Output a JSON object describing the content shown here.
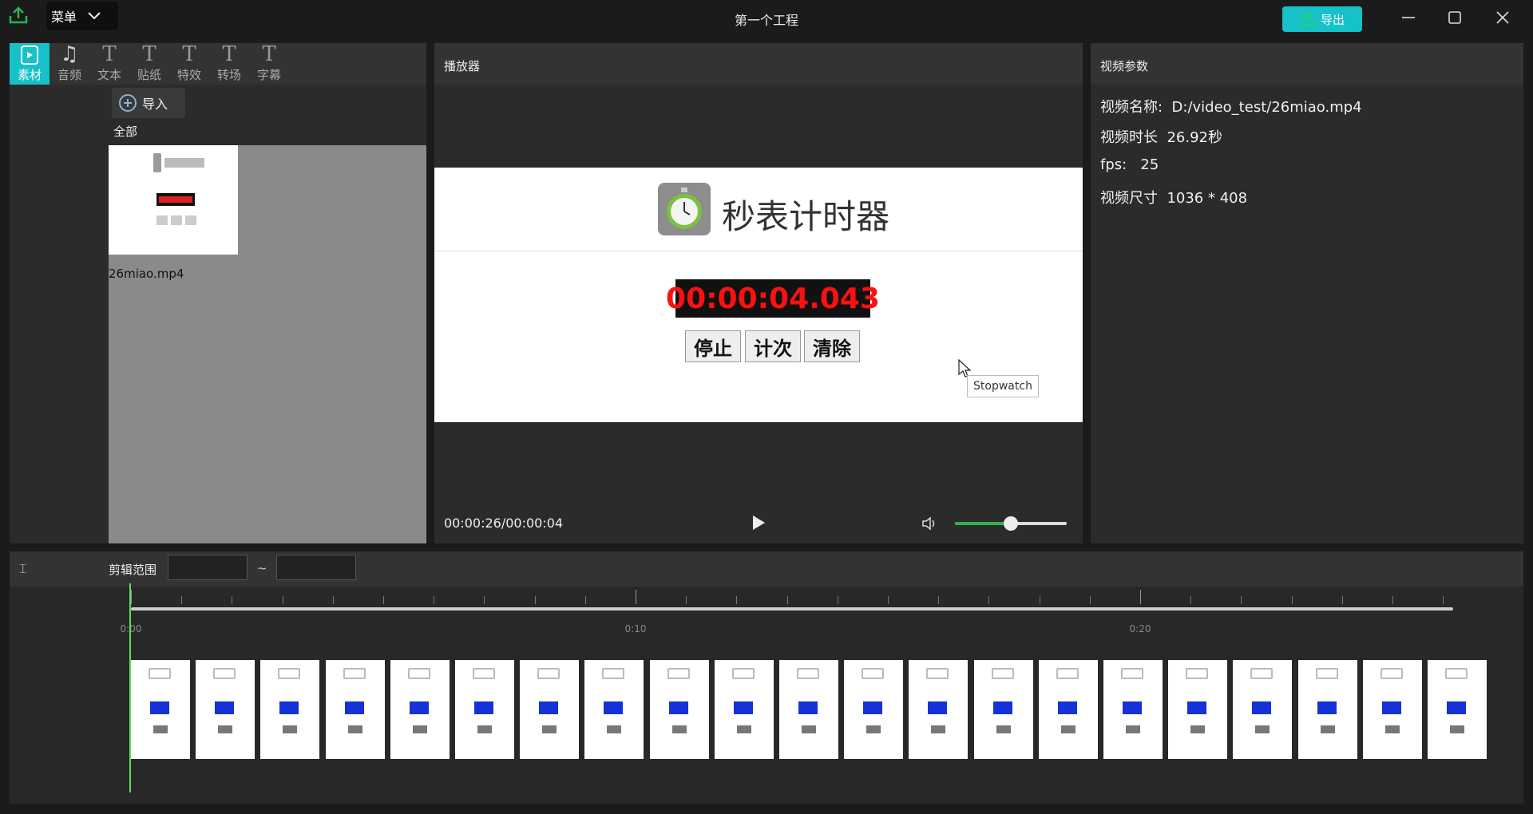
{
  "window": {
    "menu_label": "菜单",
    "title": "第一个工程",
    "export_label": "导出"
  },
  "colors": {
    "accent": "#16c1c8",
    "volume": "#2db34a",
    "playhead": "#5de05d"
  },
  "left_panel": {
    "tabs": [
      {
        "label": "素材",
        "icon": "film-icon",
        "active": true
      },
      {
        "label": "音频",
        "icon": "music-note-icon"
      },
      {
        "label": "文本",
        "icon": "text-icon"
      },
      {
        "label": "贴纸",
        "icon": "text-icon"
      },
      {
        "label": "特效",
        "icon": "text-icon"
      },
      {
        "label": "转场",
        "icon": "text-icon"
      },
      {
        "label": "字幕",
        "icon": "text-icon"
      }
    ],
    "import_label": "导入",
    "filter_label": "全部",
    "media": [
      {
        "name": "26miao.mp4"
      }
    ]
  },
  "player": {
    "header": "播放器",
    "video": {
      "title": "秒表计时器",
      "time": "00:00:04.043",
      "buttons": [
        "停止",
        "计次",
        "清除"
      ],
      "tooltip": "Stopwatch"
    },
    "time_readout": "00:00:26/00:00:04",
    "volume": 0.5
  },
  "params": {
    "header": "视频参数",
    "rows": [
      {
        "label": "视频名称:",
        "value": "D:/video_test/26miao.mp4"
      },
      {
        "label": "视频时长",
        "value": "26.92秒"
      },
      {
        "label": "fps:",
        "value": "25"
      },
      {
        "label": "视频尺寸",
        "value": "1036 * 408"
      }
    ]
  },
  "timeline": {
    "range_label": "剪辑范围",
    "range_start": "",
    "range_end": "",
    "range_separator": "~",
    "tick_labels": [
      "0:00",
      "0:10",
      "0:20"
    ],
    "frame_count": 21
  }
}
